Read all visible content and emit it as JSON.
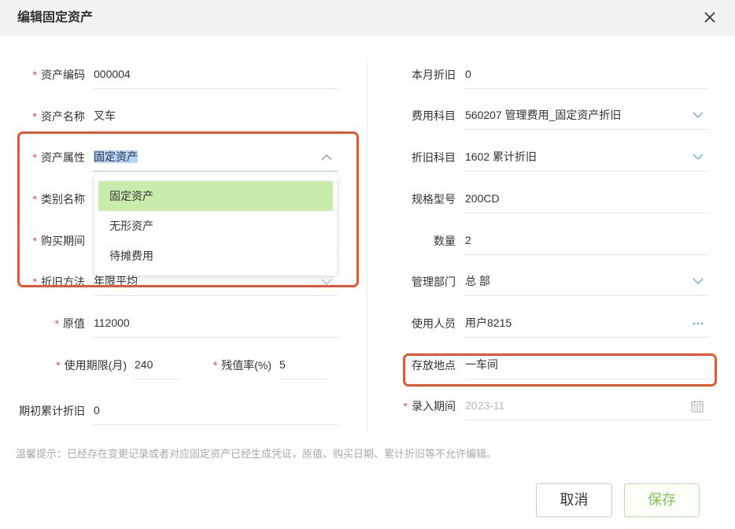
{
  "dialog": {
    "title": "编辑固定资产"
  },
  "form": {
    "required_mark": "*"
  },
  "left": {
    "asset_code": {
      "label": "资产编码",
      "value": "000004"
    },
    "asset_name": {
      "label": "资产名称",
      "value": "叉车"
    },
    "asset_attribute": {
      "label": "资产属性",
      "value": "固定资产"
    },
    "category_name": {
      "label": "类别名称"
    },
    "purchase_period": {
      "label": "购买期间"
    },
    "depreciation_method": {
      "label": "折旧方法",
      "value": "年限平均"
    },
    "original_value": {
      "label": "原值",
      "value": "112000"
    },
    "useful_life": {
      "label": "使用期限(月)",
      "value": "240"
    },
    "residual_rate": {
      "label": "残值率(%)",
      "value": "5"
    },
    "opening_accumulated_depreciation": {
      "label": "期初累计折旧",
      "value": "0"
    }
  },
  "dropdown": {
    "options": [
      "固定资产",
      "无形资产",
      "待摊费用"
    ],
    "selected_index": 0
  },
  "right": {
    "current_month_depreciation": {
      "label": "本月折旧",
      "value": "0"
    },
    "expense_account": {
      "label": "费用科目",
      "value": "560207 管理费用_固定资产折旧"
    },
    "depreciation_account": {
      "label": "折旧科目",
      "value": "1602 累计折旧"
    },
    "spec_model": {
      "label": "规格型号",
      "value": "200CD"
    },
    "quantity": {
      "label": "数量",
      "value": "2"
    },
    "department": {
      "label": "管理部门",
      "value": "总 部"
    },
    "user": {
      "label": "使用人员",
      "value": "用户8215"
    },
    "storage_location": {
      "label": "存放地点",
      "value": "一车间"
    },
    "entry_period": {
      "label": "录入期间",
      "value": "2023-11"
    }
  },
  "footer": {
    "notice": "温馨提示：已经存在变更记录或者对应固定资产已经生成凭证，原值、购买日期、累计折旧等不允许编辑。",
    "cancel_label": "取消",
    "save_label": "保存"
  },
  "icons": {
    "close": "close-icon",
    "chevron_up": "chevron-up-icon",
    "chevron_down": "chevron-down-icon",
    "more": "ellipsis-icon",
    "calendar": "calendar-icon"
  },
  "colors": {
    "required": "#e8453c",
    "option_highlight": "#c9ecad",
    "annotation": "#e8562f",
    "save_text": "#7ec45b",
    "accent_blue": "#69aee0"
  }
}
